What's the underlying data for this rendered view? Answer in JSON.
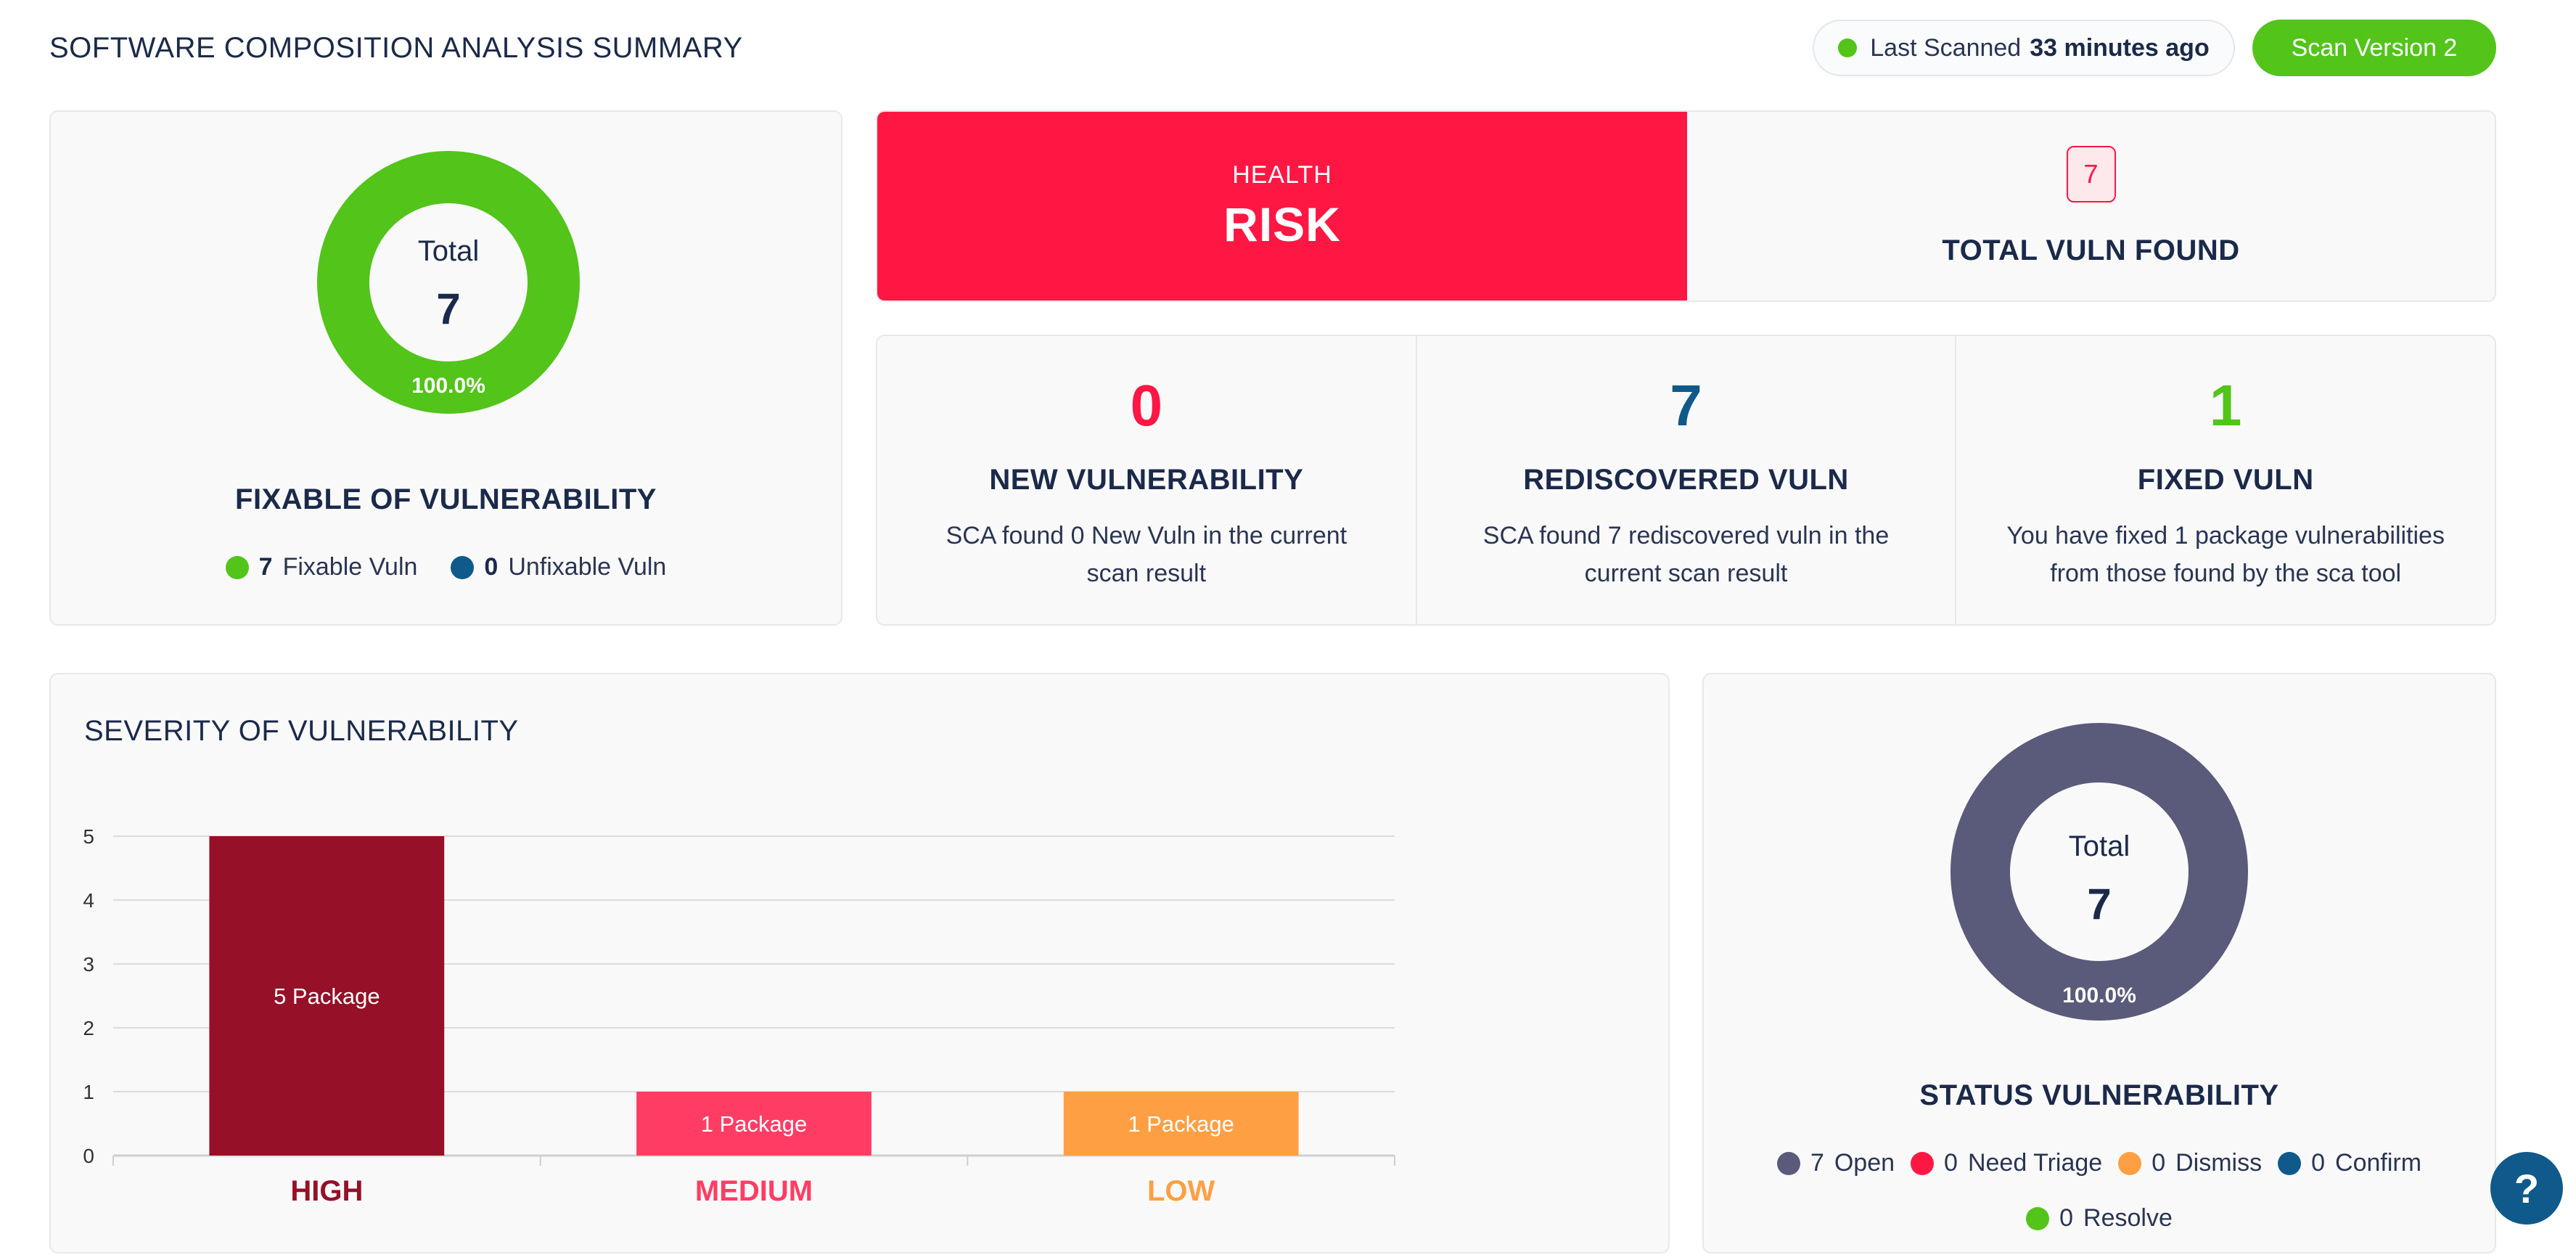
{
  "header": {
    "title": "SOFTWARE COMPOSITION ANALYSIS SUMMARY",
    "last_scanned_label": "Last Scanned",
    "last_scanned_value": "33 minutes ago",
    "scan_version_button": "Scan Version 2"
  },
  "fixable": {
    "donut_label": "Total",
    "donut_total": "7",
    "donut_percent": "100.0%",
    "title": "FIXABLE OF VULNERABILITY",
    "legend": [
      {
        "count": "7",
        "label": "Fixable Vuln",
        "color": "#52c41a"
      },
      {
        "count": "0",
        "label": "Unfixable Vuln",
        "color": "#0f5a8a"
      }
    ]
  },
  "health": {
    "label": "HEALTH",
    "value": "RISK",
    "total_count": "7",
    "total_label": "TOTAL VULN FOUND",
    "color": "#ff1744"
  },
  "stats": [
    {
      "number": "0",
      "title": "NEW VULNERABILITY",
      "desc": "SCA found 0 New Vuln in the current scan result",
      "color": "#ff1744"
    },
    {
      "number": "7",
      "title": "REDISCOVERED VULN",
      "desc": "SCA found 7 rediscovered vuln in the current scan result",
      "color": "#0f5a8a"
    },
    {
      "number": "1",
      "title": "FIXED VULN",
      "desc": "You have fixed 1 package vulnerabilities from those found by the sca tool",
      "color": "#52c41a"
    }
  ],
  "severity": {
    "title": "SEVERITY OF VULNERABILITY"
  },
  "chart_data": {
    "type": "bar",
    "title": "SEVERITY OF VULNERABILITY",
    "categories": [
      "HIGH",
      "MEDIUM",
      "LOW"
    ],
    "values": [
      5,
      1,
      1
    ],
    "data_labels": [
      "5 Package",
      "1 Package",
      "1 Package"
    ],
    "colors": [
      "#961027",
      "#ff3d64",
      "#ff9f43"
    ],
    "y_ticks": [
      "0",
      "1",
      "2",
      "3",
      "4",
      "5"
    ],
    "ylim": [
      0,
      5
    ],
    "grid": true
  },
  "status": {
    "donut_label": "Total",
    "donut_total": "7",
    "donut_percent": "100.0%",
    "title": "STATUS VULNERABILITY",
    "legend_row1": [
      {
        "count": "7",
        "label": "Open",
        "color": "#5a5a7a"
      },
      {
        "count": "0",
        "label": "Need Triage",
        "color": "#ff1744"
      },
      {
        "count": "0",
        "label": "Dismiss",
        "color": "#ff9f43"
      },
      {
        "count": "0",
        "label": "Confirm",
        "color": "#0f5a8a"
      }
    ],
    "legend_row2": [
      {
        "count": "0",
        "label": "Resolve",
        "color": "#52c41a"
      }
    ]
  },
  "help": {
    "icon": "question-icon",
    "glyph": "?"
  }
}
